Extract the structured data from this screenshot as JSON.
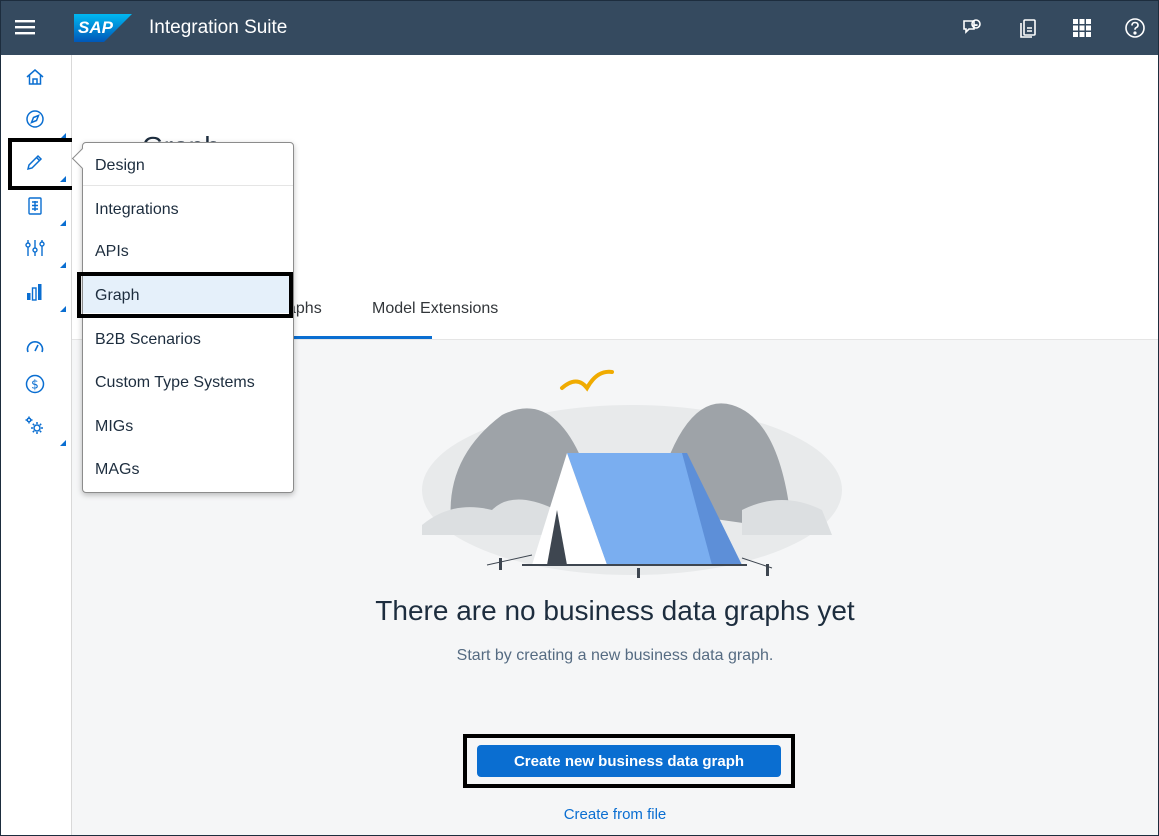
{
  "shell": {
    "logo_text": "SAP",
    "title": "Integration Suite",
    "icons": [
      "menu-icon",
      "feedback-icon",
      "notifications-icon",
      "product-switch-icon",
      "help-icon"
    ]
  },
  "sidebar": {
    "icons": [
      "home-icon",
      "discover-icon",
      "design-icon",
      "test-icon",
      "configure-icon",
      "monitor-icon",
      "performance-icon",
      "billing-icon",
      "settings-icon"
    ]
  },
  "page": {
    "title": "Graph",
    "tabs": [
      {
        "label": "Business Data Graphs",
        "visible_label": "aphs"
      },
      {
        "label": "Model Extensions"
      }
    ]
  },
  "menu": {
    "header": "Design",
    "items": [
      "Integrations",
      "APIs",
      "Graph",
      "B2B Scenarios",
      "Custom Type Systems",
      "MIGs",
      "MAGs"
    ],
    "selected": "Graph"
  },
  "empty_state": {
    "title": "There are no business data graphs yet",
    "subtitle": "Start by creating a new business data graph.",
    "primary_button": "Create new business data graph",
    "secondary_link": "Create from file"
  },
  "colors": {
    "shell_bg": "#354a5f",
    "accent": "#0a6ed1",
    "content_bg": "#f5f6f7"
  }
}
